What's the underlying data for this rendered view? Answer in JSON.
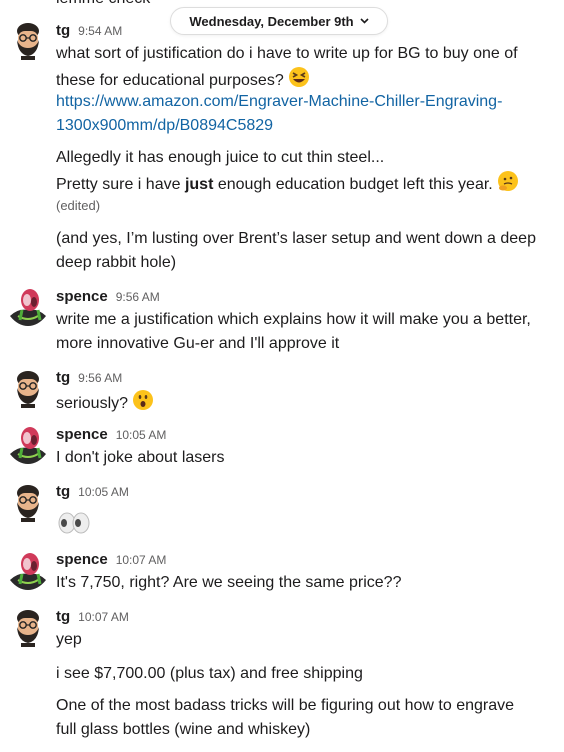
{
  "divider": {
    "date": "Wednesday, December 9th"
  },
  "top_cut_text": "lemme check",
  "icons": {
    "chevron": "chevron-down-icon",
    "avatar_tg": "bearded-man-avatar",
    "avatar_spence": "alien-robot-avatar"
  },
  "colors": {
    "link": "#1264a3",
    "muted": "#616061",
    "text": "#1d1c1d"
  },
  "messages": [
    {
      "author": "tg",
      "time": "9:54 AM",
      "lines": [
        "what sort of justification do i have to write up for BG to buy one of",
        "these for educational purposes?",
        "https://www.amazon.com/Engraver-Machine-Chiller-Engraving-",
        "1300x900mm/dp/B0894C5829",
        "Allegedly it has enough juice to cut thin steel...",
        "Pretty sure i have",
        "just",
        "enough education budget left this year.",
        "(edited)",
        "(and yes, I’m lusting over Brent’s laser setup and went down a deep",
        "deep rabbit hole)"
      ]
    },
    {
      "author": "spence",
      "time": "9:56 AM",
      "lines": [
        "write me a justification which explains how it will make you a better,",
        "more innovative Gu-er and I'll approve it"
      ]
    },
    {
      "author": "tg",
      "time": "9:56 AM",
      "lines": [
        "seriously?"
      ]
    },
    {
      "author": "spence",
      "time": "10:05 AM",
      "lines": [
        "I don't joke about lasers"
      ]
    },
    {
      "author": "tg",
      "time": "10:05 AM",
      "lines": []
    },
    {
      "author": "spence",
      "time": "10:07 AM",
      "lines": [
        "It's 7,750, right? Are we seeing the same price??"
      ]
    },
    {
      "author": "tg",
      "time": "10:07 AM",
      "lines": [
        "yep",
        "i see $7,700.00 (plus tax) and free shipping",
        "One of the most badass tricks will be figuring out how to engrave",
        "full glass bottles (wine and whiskey)"
      ]
    }
  ]
}
